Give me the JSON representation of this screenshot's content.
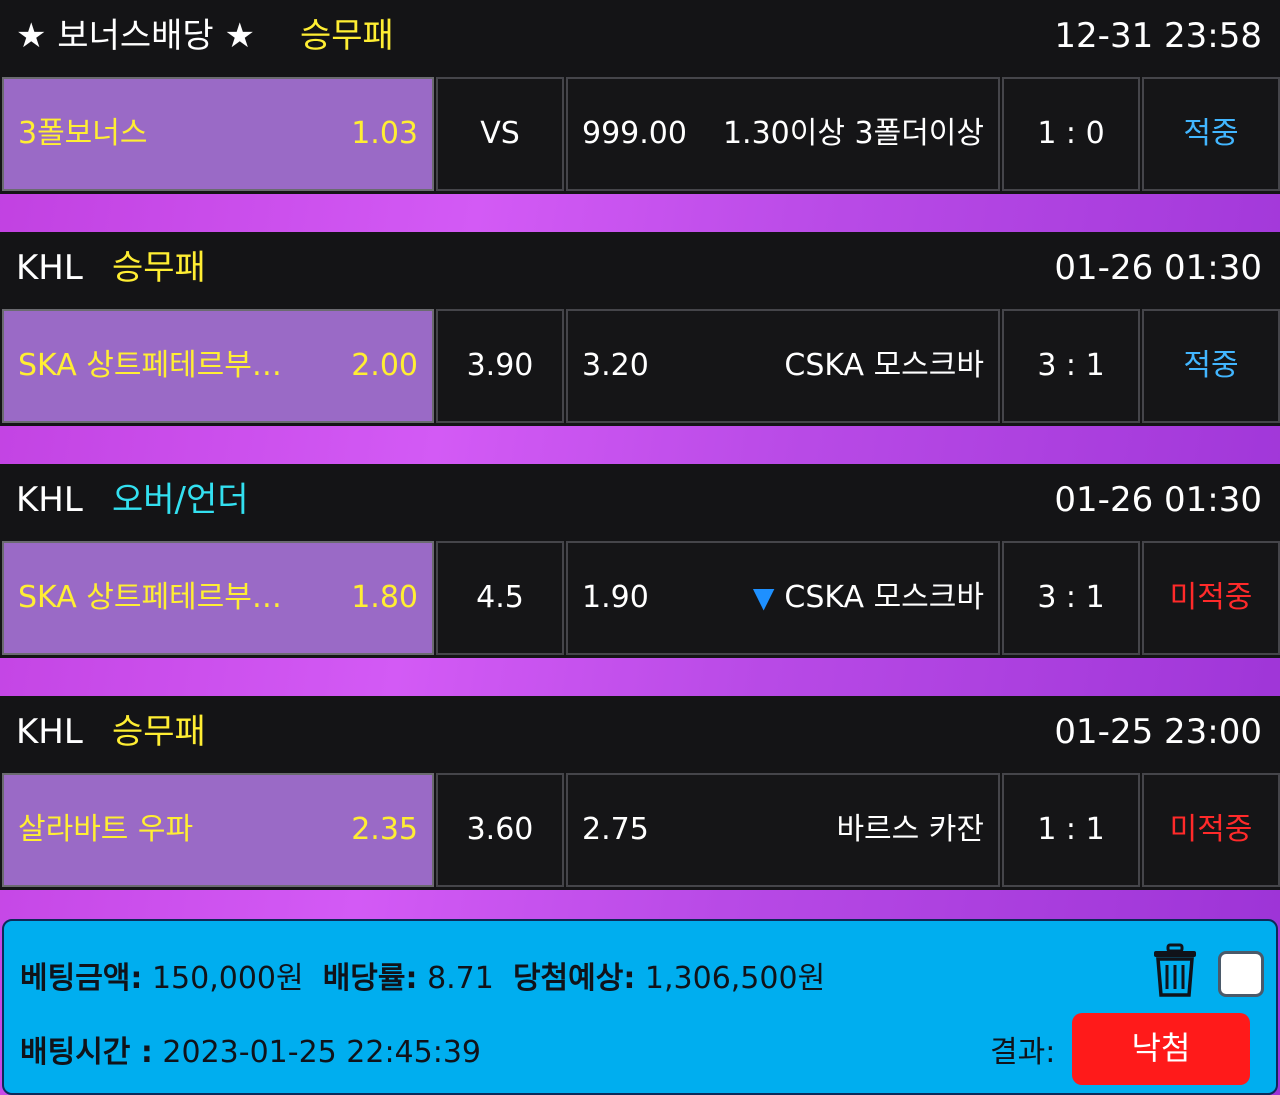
{
  "bets": [
    {
      "league": "★ 보너스배당 ★",
      "market": "승무패",
      "market_color": "#ffee33",
      "time": "12-31 23:58",
      "home_team": "3폴보너스",
      "home_odds": "1.03",
      "middle": "VS",
      "away_odds": "999.00",
      "away_arrow": "",
      "away_team": "1.30이상 3폴더이상",
      "score": "1 : 0",
      "result": "적중",
      "result_type": "win"
    },
    {
      "league": "KHL",
      "market": "승무패",
      "market_color": "#ffee33",
      "time": "01-26 01:30",
      "home_team": "SKA 상트페테르부…",
      "home_odds": "2.00",
      "middle": "3.90",
      "away_odds": "3.20",
      "away_arrow": "",
      "away_team": "CSKA 모스크바",
      "score": "3 : 1",
      "result": "적중",
      "result_type": "win"
    },
    {
      "league": "KHL",
      "market": "오버/언더",
      "market_color": "#33e0f0",
      "time": "01-26 01:30",
      "home_team": "SKA 상트페테르부…",
      "home_odds": "1.80",
      "middle": "4.5",
      "away_odds": "1.90",
      "away_arrow": "▼",
      "away_team": "CSKA 모스크바",
      "score": "3 : 1",
      "result": "미적중",
      "result_type": "lose"
    },
    {
      "league": "KHL",
      "market": "승무패",
      "market_color": "#ffee33",
      "time": "01-25 23:00",
      "home_team": "살라바트 우파",
      "home_odds": "2.35",
      "middle": "3.60",
      "away_odds": "2.75",
      "away_arrow": "",
      "away_team": "바르스 카잔",
      "score": "1 : 1",
      "result": "미적중",
      "result_type": "lose"
    }
  ],
  "summary": {
    "amount_label": "베팅금액:",
    "amount_value": "150,000원",
    "odds_label": "배당률:",
    "odds_value": "8.71",
    "expected_label": "당첨예상:",
    "expected_value": "1,306,500원",
    "time_label": "배팅시간 :",
    "time_value": "2023-01-25 22:45:39",
    "result_label": "결과:",
    "result_button": "낙첨",
    "delete_icon": "trash-icon",
    "checkbox_checked": false
  }
}
